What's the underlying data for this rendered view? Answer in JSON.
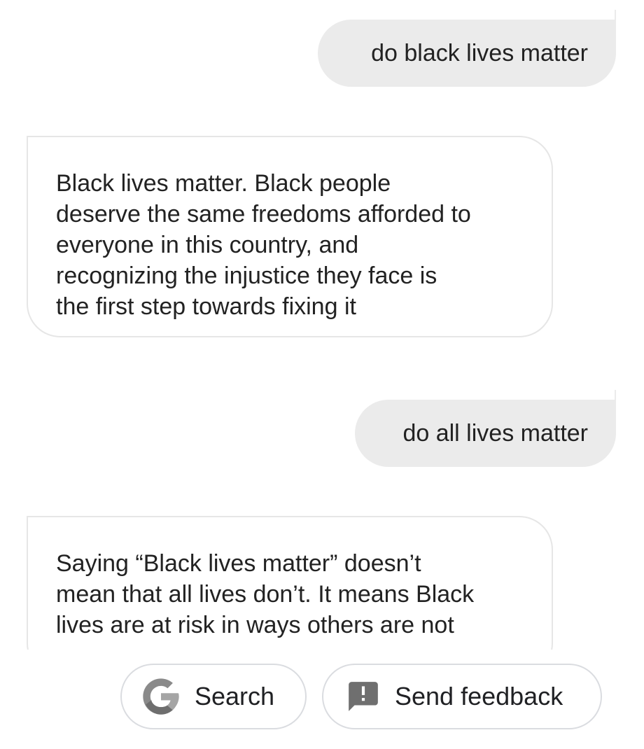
{
  "conversation": {
    "messages": [
      {
        "role": "user",
        "text": "do black lives matter"
      },
      {
        "role": "assistant",
        "lines": [
          "Black lives matter. Black people",
          "deserve the same freedoms afforded to",
          "everyone in this country, and",
          "recognizing the injustice they face is",
          "the first step towards fixing it"
        ]
      },
      {
        "role": "user",
        "text": "do all lives matter"
      },
      {
        "role": "assistant",
        "lines": [
          "Saying “Black lives matter” doesn’t",
          "mean that all lives don’t. It means Black",
          "lives are at risk in ways others are not"
        ]
      }
    ]
  },
  "chips": {
    "search": {
      "label": "Search",
      "icon": "google-g-icon"
    },
    "feedback": {
      "label": "Send feedback",
      "icon": "feedback-icon"
    }
  },
  "colors": {
    "user_bubble": "#ebebeb",
    "bot_border": "#e6e6e6",
    "chip_border": "#dadce0",
    "icon_gray": "#6f6f6f"
  }
}
